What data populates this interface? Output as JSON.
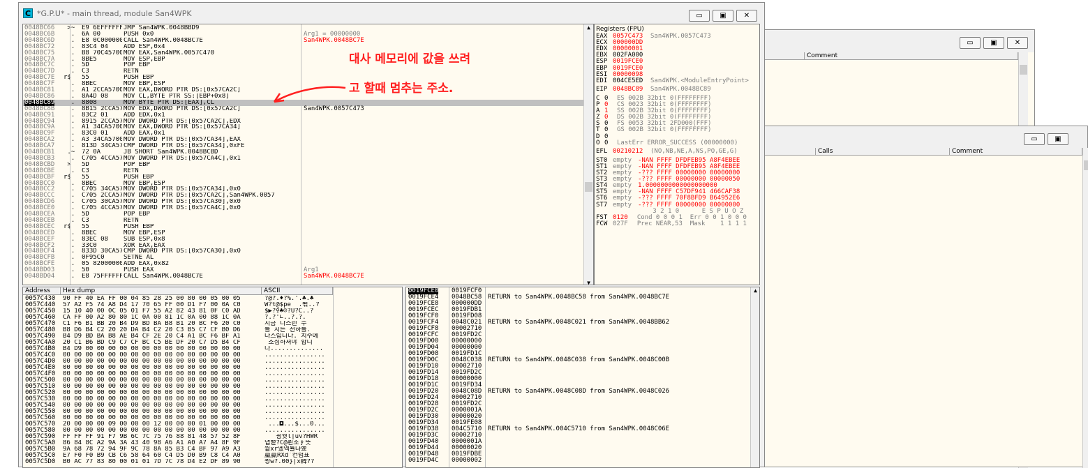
{
  "main_window": {
    "title": "*G.P.U* - main thread, module San4WPK",
    "icon_letter": "C",
    "buttons": {
      "minimize": "▭",
      "maximize": "▣",
      "close": "✕"
    }
  },
  "back_window_1": {
    "col_comment": "Comment",
    "buttons": {
      "minimize": "▭",
      "maximize": "▣",
      "close": "✕"
    }
  },
  "back_window_2": {
    "col_calls": "Calls",
    "col_comment": "Comment",
    "buttons": {
      "minimize": "▭",
      "maximize": "▣"
    }
  },
  "disasm_rows": [
    {
      "addr": "0048BC66",
      "mk": " >~",
      "hex": "E9 6EFFFFFF",
      "instr": "JMP San4WPK.0048BBD9",
      "cmt": "",
      "sel": false
    },
    {
      "addr": "0048BC6B",
      "mk": "  .",
      "hex": "6A 00",
      "instr": "PUSH 0x0",
      "cmt": "Arg1 = 00000000",
      "sel": false
    },
    {
      "addr": "0048BC6D",
      "mk": "  .",
      "hex": "E8 0C000000",
      "instr": "CALL San4WPK.0048BC7E",
      "cmt": "San4WPK.0048BC7E",
      "sel": false
    },
    {
      "addr": "0048BC72",
      "mk": "  .",
      "hex": "83C4 04",
      "instr": "ADD ESP,0x4",
      "cmt": "",
      "sel": false
    },
    {
      "addr": "0048BC75",
      "mk": "  .",
      "hex": "B8 70C45700",
      "instr": "MOV EAX,San4WPK.0057C470",
      "cmt": "",
      "sel": false
    },
    {
      "addr": "0048BC7A",
      "mk": "  .",
      "hex": "8BE5",
      "instr": "MOV ESP,EBP",
      "cmt": "",
      "sel": false
    },
    {
      "addr": "0048BC7C",
      "mk": "  .",
      "hex": "5D",
      "instr": "POP EBP",
      "cmt": "",
      "sel": false
    },
    {
      "addr": "0048BC7D",
      "mk": "  .",
      "hex": "C3",
      "instr": "RETN",
      "cmt": "",
      "sel": false
    },
    {
      "addr": "0048BC7E",
      "mk": "r$",
      "hex": "55",
      "instr": "PUSH EBP",
      "cmt": "",
      "sel": false
    },
    {
      "addr": "0048BC7F",
      "mk": "  .",
      "hex": "8BEC",
      "instr": "MOV EBP,ESP",
      "cmt": "",
      "sel": false
    },
    {
      "addr": "0048BC81",
      "mk": "  .",
      "hex": "A1 2CCA5700",
      "instr": "MOV EAX,DWORD PTR DS:[0x57CA2C]",
      "cmt": "",
      "sel": false
    },
    {
      "addr": "0048BC86",
      "mk": "  .",
      "hex": "8A4D 08",
      "instr": "MOV CL,BYTE PTR SS:[EBP+0x8]",
      "cmt": "",
      "sel": false
    },
    {
      "addr": "0048BC89",
      "mk": "  .",
      "hex": "8808",
      "instr": "MOV BYTE PTR DS:[EAX],CL",
      "cmt": "",
      "sel": true
    },
    {
      "addr": "0048BC8B",
      "mk": "  .",
      "hex": "8B15 2CCA5700",
      "instr": "MOV EDX,DWORD PTR DS:[0x57CA2C]",
      "cmt": "San4WPK.0057C473",
      "sel": false
    },
    {
      "addr": "0048BC91",
      "mk": "  .",
      "hex": "83C2 01",
      "instr": "ADD EDX,0x1",
      "cmt": "",
      "sel": false
    },
    {
      "addr": "0048BC94",
      "mk": "  .",
      "hex": "8915 2CCA5700",
      "instr": "MOV DWORD PTR DS:[0x57CA2C],EDX",
      "cmt": "",
      "sel": false
    },
    {
      "addr": "0048BC9A",
      "mk": "  .",
      "hex": "A1 34CA5700",
      "instr": "MOV EAX,DWORD PTR DS:[0x57CA34]",
      "cmt": "",
      "sel": false
    },
    {
      "addr": "0048BC9F",
      "mk": "  .",
      "hex": "83C0 01",
      "instr": "ADD EAX,0x1",
      "cmt": "",
      "sel": false
    },
    {
      "addr": "0048BCA2",
      "mk": "  .",
      "hex": "A3 34CA5700",
      "instr": "MOV DWORD PTR DS:[0x57CA34],EAX",
      "cmt": "",
      "sel": false
    },
    {
      "addr": "0048BCA7",
      "mk": "  .",
      "hex": "813D 34CA5700",
      "instr": "CMP DWORD PTR DS:[0x57CA34],0xFE",
      "cmt": "",
      "sel": false
    },
    {
      "addr": "0048BCB1",
      "mk": " .~",
      "hex": "72 0A",
      "instr": "JB SHORT San4WPK.0048BCBD",
      "cmt": "",
      "sel": false
    },
    {
      "addr": "0048BCB3",
      "mk": "  .",
      "hex": "C705 4CCA5700",
      "instr": "MOV DWORD PTR DS:[0x57CA4C],0x1",
      "cmt": "",
      "sel": false
    },
    {
      "addr": "0048BCBD",
      "mk": " >",
      "hex": "5D",
      "instr": "POP EBP",
      "cmt": "",
      "sel": false
    },
    {
      "addr": "0048BCBE",
      "mk": "  .",
      "hex": "C3",
      "instr": "RETN",
      "cmt": "",
      "sel": false
    },
    {
      "addr": "0048BCBF",
      "mk": "r$",
      "hex": "55",
      "instr": "PUSH EBP",
      "cmt": "",
      "sel": false
    },
    {
      "addr": "0048BCC0",
      "mk": "  .",
      "hex": "8BEC",
      "instr": "MOV EBP,ESP",
      "cmt": "",
      "sel": false
    },
    {
      "addr": "0048BCC2",
      "mk": "  .",
      "hex": "C705 34CA5700",
      "instr": "MOV DWORD PTR DS:[0x57CA34],0x0",
      "cmt": "",
      "sel": false
    },
    {
      "addr": "0048BCCC",
      "mk": "  .",
      "hex": "C705 2CCA5700",
      "instr": "MOV DWORD PTR DS:[0x57CA2C],San4WPK.0057",
      "cmt": "",
      "sel": false
    },
    {
      "addr": "0048BCD6",
      "mk": "  .",
      "hex": "C705 30CA5700",
      "instr": "MOV DWORD PTR DS:[0x57CA30],0x0",
      "cmt": "",
      "sel": false
    },
    {
      "addr": "0048BCE0",
      "mk": "  .",
      "hex": "C705 4CCA5700",
      "instr": "MOV DWORD PTR DS:[0x57CA4C],0x0",
      "cmt": "",
      "sel": false
    },
    {
      "addr": "0048BCEA",
      "mk": "  .",
      "hex": "5D",
      "instr": "POP EBP",
      "cmt": "",
      "sel": false
    },
    {
      "addr": "0048BCEB",
      "mk": "  .",
      "hex": "C3",
      "instr": "RETN",
      "cmt": "",
      "sel": false
    },
    {
      "addr": "0048BCEC",
      "mk": "r$",
      "hex": "55",
      "instr": "PUSH EBP",
      "cmt": "",
      "sel": false
    },
    {
      "addr": "0048BCED",
      "mk": "  .",
      "hex": "8BEC",
      "instr": "MOV EBP,ESP",
      "cmt": "",
      "sel": false
    },
    {
      "addr": "0048BCEF",
      "mk": "  .",
      "hex": "83EC 08",
      "instr": "SUB ESP,0x8",
      "cmt": "",
      "sel": false
    },
    {
      "addr": "0048BCF2",
      "mk": "  .",
      "hex": "33C0",
      "instr": "XOR EAX,EAX",
      "cmt": "",
      "sel": false
    },
    {
      "addr": "0048BCF4",
      "mk": "  .",
      "hex": "833D 30CA5700",
      "instr": "CMP DWORD PTR DS:[0x57CA30],0x0",
      "cmt": "",
      "sel": false
    },
    {
      "addr": "0048BCFB",
      "mk": "  .",
      "hex": "0F95C0",
      "instr": "SETNE AL",
      "cmt": "",
      "sel": false
    },
    {
      "addr": "0048BCFE",
      "mk": "  .",
      "hex": "05 82000000",
      "instr": "ADD EAX,0x82",
      "cmt": "",
      "sel": false
    },
    {
      "addr": "0048BD03",
      "mk": "  .",
      "hex": "50",
      "instr": "PUSH EAX",
      "cmt": "Arg1",
      "sel": false
    },
    {
      "addr": "0048BD04",
      "mk": "  .",
      "hex": "E8 75FFFFFF",
      "instr": "CALL San4WPK.0048BC7E",
      "cmt": "San4WPK.0048BC7E",
      "sel": false
    }
  ],
  "registers": {
    "title": "Registers (FPU)",
    "gp": [
      {
        "n": "EAX",
        "v": "0057C473",
        "c": "San4WPK.0057C473",
        "red": true
      },
      {
        "n": "ECX",
        "v": "000000DD",
        "c": "",
        "red": true
      },
      {
        "n": "EDX",
        "v": "00000001",
        "c": "",
        "red": true
      },
      {
        "n": "EBX",
        "v": "002FA000",
        "c": "",
        "red": false
      },
      {
        "n": "ESP",
        "v": "0019FCE0",
        "c": "",
        "red": true
      },
      {
        "n": "EBP",
        "v": "0019FCE0",
        "c": "",
        "red": true
      },
      {
        "n": "ESI",
        "v": "00000098",
        "c": "",
        "red": true
      },
      {
        "n": "EDI",
        "v": "004CE5ED",
        "c": "San4WPK.<ModuleEntryPoint>",
        "red": false
      }
    ],
    "eip": {
      "n": "EIP",
      "v": "0048BC89",
      "c": "San4WPK.0048BC89"
    },
    "flags": [
      {
        "f": "C",
        "b": "0",
        "s": "ES 002B 32bit 0(FFFFFFFF)",
        "red": false
      },
      {
        "f": "P",
        "b": "0",
        "s": "CS 0023 32bit 0(FFFFFFFF)",
        "red": true
      },
      {
        "f": "A",
        "b": "1",
        "s": "SS 002B 32bit 0(FFFFFFFF)",
        "red": true
      },
      {
        "f": "Z",
        "b": "0",
        "s": "DS 002B 32bit 0(FFFFFFFF)",
        "red": true
      },
      {
        "f": "S",
        "b": "0",
        "s": "FS 0053 32bit 2FD000(FFF)",
        "red": false
      },
      {
        "f": "T",
        "b": "0",
        "s": "GS 002B 32bit 0(FFFFFFFF)",
        "red": false
      },
      {
        "f": "D",
        "b": "0",
        "s": "",
        "red": false
      },
      {
        "f": "O",
        "b": "0",
        "s": "LastErr ERROR_SUCCESS (00000000)",
        "red": false
      }
    ],
    "efl": {
      "n": "EFL",
      "v": "00210212",
      "c": "(NO,NB,NE,A,NS,PO,GE,G)"
    },
    "st": [
      {
        "n": "ST0",
        "t": "empty",
        "v": "-NAN FFFF DFDFEB95 A8F4EBEE"
      },
      {
        "n": "ST1",
        "t": "empty",
        "v": "-NAN FFFF DFDFEB95 A8F4EBEE"
      },
      {
        "n": "ST2",
        "t": "empty",
        "v": "-??? FFFF 00000000 00000000"
      },
      {
        "n": "ST3",
        "t": "empty",
        "v": "-??? FFFF 00000000 00000050"
      },
      {
        "n": "ST4",
        "t": "empty",
        "v": "1.0000000000000000000"
      },
      {
        "n": "ST5",
        "t": "empty",
        "v": "-NAN FFFF C57DF941 466CAF38"
      },
      {
        "n": "ST6",
        "t": "empty",
        "v": "-??? FFFF 70F8BFD9 B64952E6"
      },
      {
        "n": "ST7",
        "t": "empty",
        "v": "-??? FFFF 00000000 00000000"
      }
    ],
    "fpu_hdr": "               3 2 1 0      E S P U O Z",
    "fst": {
      "label": "FST",
      "v": "0120",
      "rest": "  Cond 0 0 0 1  Err 0 0 1 0 0 0"
    },
    "fcw": {
      "label": "FCW",
      "v": "027F",
      "rest": "  Prec NEAR,53  Mask    1 1 1 1"
    }
  },
  "dump": {
    "col_address": "Address",
    "col_hex": "Hex dump",
    "col_ascii": "ASCII",
    "rows": [
      {
        "a": "0057C430",
        "h": "90 FF 40 EA FF 00 04 85 28 25 00 80 00 05 00 05",
        "s": "?@?.♦?%.'.♣.♣"
      },
      {
        "a": "0057C440",
        "h": "57 A2 F5 74 A8 D4 17 70 65 FF 00 D1 F7 00 0A C0",
        "s": "W?t@$pe  .뾖..?"
      },
      {
        "a": "0057C450",
        "h": "15 10 40 00 0C 05 01 F7 55 A2 82 43 81 0F C0 AD",
        "s": "$▶?♀♣☺?U?C..?"
      },
      {
        "a": "0057C460",
        "h": "CA FF 00 A2 80 80 1C 0A 00 81 1C 0A 00 88 1C 0A",
        "s": "?.?'∟..?.?."
      },
      {
        "a": "0057C470",
        "h": "C1 F6 B1 BB 20 B4 D9 BD BA B8 B1 20 BC F6 20 C0",
        "s": "지금 다스린 수"
      },
      {
        "a": "0057C480",
        "h": "B8 D6 B4 C2 20 20 DA B4 C2 20 C3 B5 C7 CF B0 D6",
        "s": "를 지는 천하를."
      },
      {
        "a": "0057C490",
        "h": "B4 D9 BD BA B8 AE B4 CF 2E 20 C4 A1 BC F6 BF A1",
        "s": "다스립니다. 치수에"
      },
      {
        "a": "0057C4A0",
        "h": "20 C1 B6 BD C9 C7 CF BC C5 BE DF 20 C7 D5 B4 CF",
        "s": " 조심하셔야 합니"
      },
      {
        "a": "0057C4B0",
        "h": "B4 D9 00 00 00 00 00 00 00 00 00 00 00 00 00 00",
        "s": "다.............."
      },
      {
        "a": "0057C4C0",
        "h": "00 00 00 00 00 00 00 00 00 00 00 00 00 00 00 00",
        "s": "................"
      },
      {
        "a": "0057C4D0",
        "h": "00 00 00 00 00 00 00 00 00 00 00 00 00 00 00 00",
        "s": "................"
      },
      {
        "a": "0057C4E0",
        "h": "00 00 00 00 00 00 00 00 00 00 00 00 00 00 00 00",
        "s": "................"
      },
      {
        "a": "0057C4F0",
        "h": "00 00 00 00 00 00 00 00 00 00 00 00 00 00 00 00",
        "s": "................"
      },
      {
        "a": "0057C500",
        "h": "00 00 00 00 00 00 00 00 00 00 00 00 00 00 00 00",
        "s": "................"
      },
      {
        "a": "0057C510",
        "h": "00 00 00 00 00 00 00 00 00 00 00 00 00 00 00 00",
        "s": "................"
      },
      {
        "a": "0057C520",
        "h": "00 00 00 00 00 00 00 00 00 00 00 00 00 00 00 00",
        "s": "................"
      },
      {
        "a": "0057C530",
        "h": "00 00 00 00 00 00 00 00 00 00 00 00 00 00 00 00",
        "s": "................"
      },
      {
        "a": "0057C540",
        "h": "00 00 00 00 00 00 00 00 00 00 00 00 00 00 00 00",
        "s": "................"
      },
      {
        "a": "0057C550",
        "h": "00 00 00 00 00 00 00 00 00 00 00 00 00 00 00 00",
        "s": "................"
      },
      {
        "a": "0057C560",
        "h": "00 00 00 00 00 00 00 00 00 00 00 00 00 00 00 00",
        "s": "................"
      },
      {
        "a": "0057C570",
        "h": "20 00 00 00 09 00 00 00 12 00 00 00 01 00 00 00",
        "s": " ...◘...$...0..."
      },
      {
        "a": "0057C580",
        "h": "00 00 00 00 00 00 00 00 00 00 00 00 00 00 00 00",
        "s": "................"
      },
      {
        "a": "0057C590",
        "h": "FF FF FF 91 F7 9B 6C 7C 75 76 88 81 48 57 52 8F",
        "s": "   굉꿧l|uv?HWR"
      },
      {
        "a": "0057C5A0",
        "h": "86 84 8C A2 9A 3A 43 40 98 A6 A1 A0 A7 A4 8F 9F",
        "s": "냅뱉?C@뢴조∮뜻"
      },
      {
        "a": "0057C5B0",
        "h": "9A 68 78 72 94 9F 9C 78 8A 85 B3 C4 BF 97 A9 A3",
        "s": "붵xr옜엑률나뾰"
      },
      {
        "a": "0057C5C0",
        "h": "E7 F0 F0 B9 CB C6 58 64 60 C4 D5 D0 B9 C8 C4 A0",
        "s": "羸羸RXd`컨렵표"
      },
      {
        "a": "0057C5D0",
        "h": "B0 AC 77 83 80 00 01 01 7D 7C 78 D4 E2 DF 89 90",
        "s": "쾅w?.00}|x韓??"
      }
    ]
  },
  "stack": {
    "rows": [
      {
        "a": "0019FCE0",
        "v": "0019FCF0",
        "c": "",
        "sel": true
      },
      {
        "a": "0019FCE4",
        "v": "0048BC58",
        "c": "RETURN to San4WPK.0048BC58 from San4WPK.0048BC7E",
        "sel": false
      },
      {
        "a": "0019FCE8",
        "v": "000000DD",
        "c": "",
        "sel": false
      },
      {
        "a": "0019FCEC",
        "v": "0019FDB1",
        "c": "",
        "sel": false
      },
      {
        "a": "0019FCF0",
        "v": "0019FD08",
        "c": "",
        "sel": false
      },
      {
        "a": "0019FCF4",
        "v": "0048C021",
        "c": "RETURN to San4WPK.0048C021 from San4WPK.0048BB62",
        "sel": false
      },
      {
        "a": "0019FCF8",
        "v": "00002710",
        "c": "",
        "sel": false
      },
      {
        "a": "0019FCFC",
        "v": "0019FD2C",
        "c": "",
        "sel": false
      },
      {
        "a": "0019FD00",
        "v": "00000000",
        "c": "",
        "sel": false
      },
      {
        "a": "0019FD04",
        "v": "00000000",
        "c": "",
        "sel": false
      },
      {
        "a": "0019FD08",
        "v": "0019FD1C",
        "c": "",
        "sel": false
      },
      {
        "a": "0019FD0C",
        "v": "0048C038",
        "c": "RETURN to San4WPK.0048C038 from San4WPK.0048C00B",
        "sel": false
      },
      {
        "a": "0019FD10",
        "v": "00002710",
        "c": "",
        "sel": false
      },
      {
        "a": "0019FD14",
        "v": "0019FD2C",
        "c": "",
        "sel": false
      },
      {
        "a": "0019FD18",
        "v": "00000000",
        "c": "",
        "sel": false
      },
      {
        "a": "0019FD1C",
        "v": "0019FD34",
        "c": "",
        "sel": false
      },
      {
        "a": "0019FD20",
        "v": "0048C08D",
        "c": "RETURN to San4WPK.0048C08D from San4WPK.0048C026",
        "sel": false
      },
      {
        "a": "0019FD24",
        "v": "00002710",
        "c": "",
        "sel": false
      },
      {
        "a": "0019FD28",
        "v": "0019FD2C",
        "c": "",
        "sel": false
      },
      {
        "a": "0019FD2C",
        "v": "0000001A",
        "c": "",
        "sel": false
      },
      {
        "a": "0019FD30",
        "v": "00000020",
        "c": "",
        "sel": false
      },
      {
        "a": "0019FD34",
        "v": "0019FE08",
        "c": "",
        "sel": false
      },
      {
        "a": "0019FD38",
        "v": "004C5710",
        "c": "RETURN to San4WPK.004C5710 from San4WPK.0048C06E",
        "sel": false
      },
      {
        "a": "0019FD3C",
        "v": "00002710",
        "c": "",
        "sel": false
      },
      {
        "a": "0019FD40",
        "v": "0000001A",
        "c": "",
        "sel": false
      },
      {
        "a": "0019FD44",
        "v": "00000020",
        "c": "",
        "sel": false
      },
      {
        "a": "0019FD48",
        "v": "0019FDBE",
        "c": "",
        "sel": false
      },
      {
        "a": "0019FD4C",
        "v": "00000002",
        "c": "",
        "sel": false
      }
    ]
  },
  "annotation": {
    "line1": "대사 메모리에 값을 쓰려",
    "line2": "고 할때 멈추는 주소.",
    "color": "#ff2020"
  }
}
